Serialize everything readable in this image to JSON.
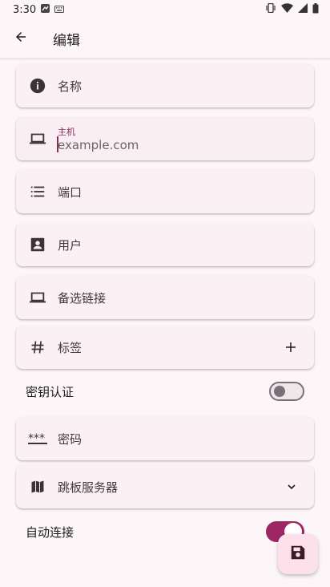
{
  "status": {
    "time": "3:30"
  },
  "appbar": {
    "title": "编辑"
  },
  "fields": {
    "name": {
      "label": "名称"
    },
    "host": {
      "label": "主机",
      "placeholder": "example.com"
    },
    "port": {
      "label": "端口"
    },
    "user": {
      "label": "用户"
    },
    "alt_link": {
      "label": "备选链接"
    },
    "tags": {
      "label": "标签"
    },
    "password": {
      "label": "密码"
    },
    "jump_server": {
      "label": "跳板服务器"
    }
  },
  "toggles": {
    "key_auth": {
      "label": "密钥认证",
      "on": false
    },
    "auto_connect": {
      "label": "自动连接",
      "on": true
    }
  },
  "colors": {
    "accent": "#9c2762",
    "background": "#fdf6f8",
    "fab": "#fde1ea"
  },
  "icons": [
    "back-arrow-icon",
    "info-icon",
    "laptop-icon",
    "list-icon",
    "contact-card-icon",
    "hash-icon",
    "plus-icon",
    "asterisk-password-icon",
    "map-icon",
    "chevron-down-icon",
    "save-icon"
  ]
}
